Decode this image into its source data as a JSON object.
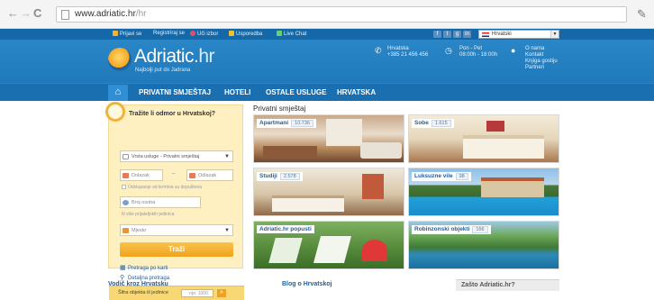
{
  "browser": {
    "url_host": "www.adriatic.hr",
    "url_path": "/hr"
  },
  "topbar": {
    "items": [
      {
        "label": "Prijavi se",
        "color": "#f5b335"
      },
      {
        "label": "Registriraj se",
        "color": "#f5b335"
      },
      {
        "label": "Uči izbor",
        "color": "#e2506a"
      },
      {
        "label": "Usporedba",
        "color": "#f0c030"
      },
      {
        "label": "Live Chat",
        "color": "#6ad06a"
      }
    ],
    "social": [
      "f",
      "t",
      "g",
      "in",
      "▶"
    ],
    "language": "Hrvatski"
  },
  "header": {
    "logo_main": "Adriatic",
    "logo_suffix": ".hr",
    "tagline": "Najbolji put do Jadrana",
    "contact_label": "Hrvatska",
    "contact_phone": "+385 21 456 456",
    "hours_label": "Pon - Pet",
    "hours_value": "08:00h - 18:00h",
    "links": [
      "O nama",
      "Kontakt",
      "Knjiga gostiju",
      "Partneri"
    ]
  },
  "nav": {
    "items": [
      "PRIVATNI SMJEŠTAJ",
      "HOTELI",
      "OSTALE USLUGE",
      "HRVATSKA"
    ]
  },
  "search": {
    "title": "Tražite li odmor u Hrvatskoj?",
    "service_value": "Vrsta usluge - Privatni smještaj",
    "checkin_placeholder": "Dolazak",
    "checkout_placeholder": "Odlazak",
    "dash": "–",
    "flexible_note": "Odstupanje od termina su dopuštena",
    "persons_placeholder": "Broj osoba",
    "persons_note": "Ili više prijateljskih jedinica",
    "place_placeholder": "Mjesto",
    "submit_label": "Traži",
    "map_link": "Pretraga po karti",
    "detailed_link": "Detaljna pretraga",
    "bottom_label": "Šifra objekta ili jedinice",
    "code_placeholder": "npr. 1000",
    "go_label": "»"
  },
  "listings": {
    "section_title": "Privatni smještaj",
    "tiles": [
      {
        "label": "Apartmani",
        "count": "10.736"
      },
      {
        "label": "Sobe",
        "count": "1.615"
      },
      {
        "label": "Studiji",
        "count": "2.578"
      },
      {
        "label": "Luksuzne vile",
        "count": "98"
      },
      {
        "label": "Adriatic.hr popusti",
        "count": ""
      },
      {
        "label": "Robinzonski objekti",
        "count": "166"
      }
    ]
  },
  "footer": {
    "guide": "Vodič kroz Hrvatsku",
    "blog": "Blog o Hrvatskoj",
    "why": "Zašto Adriatic.hr?"
  }
}
